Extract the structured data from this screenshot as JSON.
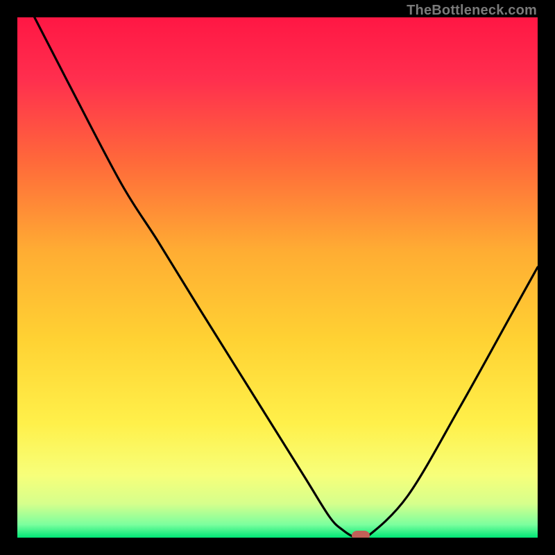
{
  "watermark": {
    "text": "TheBottleneck.com"
  },
  "chart_data": {
    "type": "line",
    "title": "",
    "xlabel": "",
    "ylabel": "",
    "xlim": [
      0,
      100
    ],
    "ylim": [
      0,
      100
    ],
    "series": [
      {
        "name": "curve",
        "x": [
          3.3,
          10,
          20,
          27,
          35,
          45,
          55,
          60,
          62.5,
          65,
          67,
          75,
          85,
          95,
          100
        ],
        "y": [
          100,
          87,
          68,
          57,
          44,
          28,
          12,
          4,
          1.5,
          0,
          0,
          8,
          25,
          43,
          52
        ]
      }
    ],
    "marker": {
      "x": 66,
      "y": 0
    },
    "gradient_stops": [
      {
        "offset": 0,
        "color": "#ff1744"
      },
      {
        "offset": 0.12,
        "color": "#ff2f4e"
      },
      {
        "offset": 0.28,
        "color": "#ff6a3a"
      },
      {
        "offset": 0.45,
        "color": "#ffad33"
      },
      {
        "offset": 0.62,
        "color": "#ffd233"
      },
      {
        "offset": 0.78,
        "color": "#fff04a"
      },
      {
        "offset": 0.88,
        "color": "#f7ff7a"
      },
      {
        "offset": 0.935,
        "color": "#d6ff8c"
      },
      {
        "offset": 0.975,
        "color": "#7bff9e"
      },
      {
        "offset": 1.0,
        "color": "#00e676"
      }
    ],
    "marker_color": "#c06058"
  }
}
